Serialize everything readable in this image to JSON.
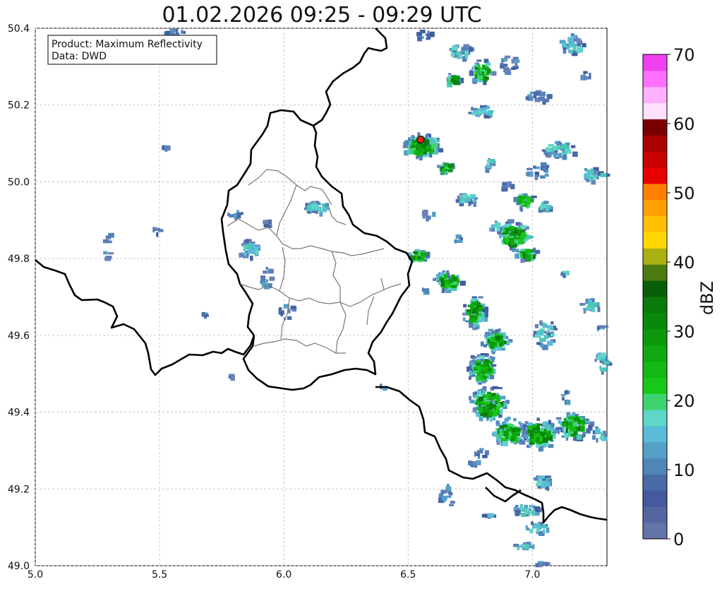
{
  "title": "01.02.2026 09:25 - 09:29 UTC",
  "legend_box": {
    "line1": "Product: Maximum Reflectivity",
    "line2": "Data: DWD"
  },
  "map": {
    "lon_range": [
      5.0,
      7.3
    ],
    "lat_range": [
      49.0,
      50.4
    ],
    "x_ticks": [
      "5.0",
      "5.5",
      "6.0",
      "6.5",
      "7.0"
    ],
    "y_ticks": [
      "49.0",
      "49.2",
      "49.4",
      "49.6",
      "49.8",
      "50.0",
      "50.2",
      "50.4"
    ],
    "grid": true,
    "marker": {
      "lon": 6.55,
      "lat": 50.11,
      "color": "#e02020"
    }
  },
  "colorbar": {
    "label": "dBZ",
    "ticks": [
      "0",
      "10",
      "20",
      "30",
      "40",
      "50",
      "60",
      "70"
    ],
    "range": [
      0,
      70
    ],
    "colors": [
      "#6474a8",
      "#5466a2",
      "#4459a0",
      "#4a6aa8",
      "#4f86b8",
      "#55a0c8",
      "#5bbcd8",
      "#5ed6c8",
      "#3dd470",
      "#18c818",
      "#14b814",
      "#10a810",
      "#0c980c",
      "#0a880a",
      "#0a7a0a",
      "#085e08",
      "#4a7a10",
      "#aab010",
      "#ffd800",
      "#ffc000",
      "#ffa000",
      "#ff8000",
      "#e60000",
      "#c80000",
      "#aa0000",
      "#7a0000",
      "#ffe0ff",
      "#ffb0ff",
      "#ff70ff",
      "#f040f0"
    ]
  }
}
